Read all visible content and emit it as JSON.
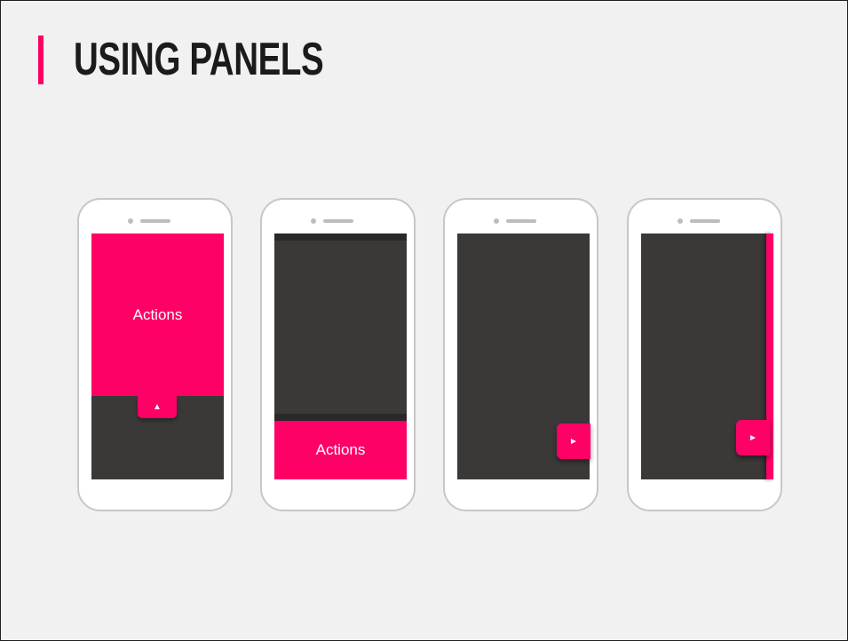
{
  "slide": {
    "title": "USING PANELS",
    "accent_color": "#ff0066",
    "screen_color": "#3b3938",
    "background_color": "#f1f1f1"
  },
  "phones": [
    {
      "panel_label": "Actions",
      "tab_icon": "▲",
      "tab_icon_name": "triangle-up-icon"
    },
    {
      "panel_label": "Actions"
    },
    {
      "tab_icon": "►",
      "tab_icon_name": "triangle-right-icon"
    },
    {
      "tab_icon": "►",
      "tab_icon_name": "triangle-right-icon"
    }
  ]
}
